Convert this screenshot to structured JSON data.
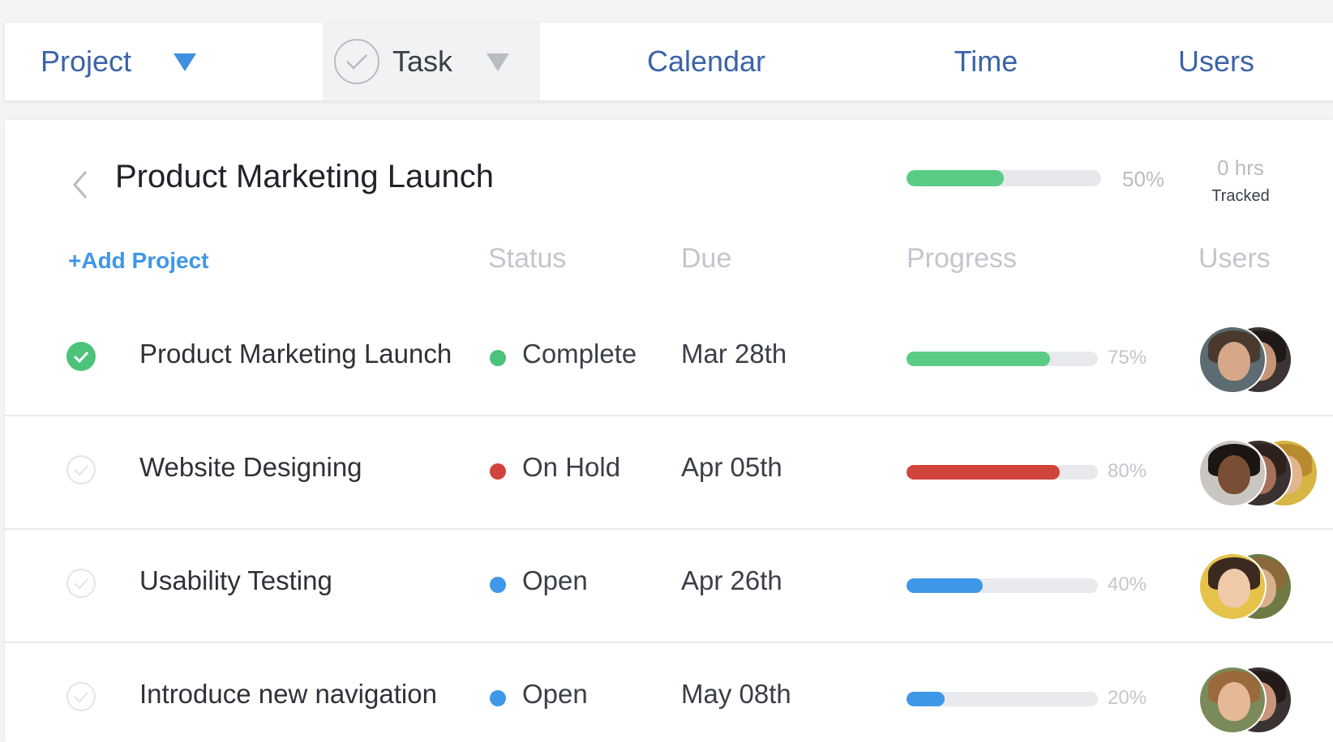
{
  "nav": {
    "project": "Project",
    "task": "Task",
    "calendar": "Calendar",
    "time": "Time",
    "users": "Users"
  },
  "header": {
    "title": "Product Marketing Launch",
    "progress": 50,
    "progress_label": "50%",
    "hours_value": "0 hrs",
    "hours_label": "Tracked"
  },
  "table": {
    "add_project": "+Add Project",
    "columns": {
      "status": "Status",
      "due": "Due",
      "progress": "Progress",
      "users": "Users"
    },
    "rows": [
      {
        "name": "Product Marketing Launch",
        "done": true,
        "status": "Complete",
        "status_color": "#4cc27a",
        "due": "Mar 28th",
        "progress": 75,
        "progress_label": "75%",
        "bar_color": "#5bcc85",
        "avatars": [
          {
            "skin": "#d6a889",
            "hair": "#4a3a2e",
            "bg": "#5d6b72"
          },
          {
            "skin": "#c59478",
            "hair": "#1f1a18",
            "bg": "#3c3533"
          }
        ]
      },
      {
        "name": "Website Designing",
        "done": false,
        "status": "On Hold",
        "status_color": "#d1443c",
        "due": "Apr 05th",
        "progress": 80,
        "progress_label": "80%",
        "bar_color": "#d1443c",
        "avatars": [
          {
            "skin": "#7a4e35",
            "hair": "#1b1513",
            "bg": "#c9c6c2"
          },
          {
            "skin": "#a4705a",
            "hair": "#2e211c",
            "bg": "#3a3230"
          },
          {
            "skin": "#e2b58f",
            "hair": "#b88a2e",
            "bg": "#d7b544"
          }
        ]
      },
      {
        "name": "Usability Testing",
        "done": false,
        "status": "Open",
        "status_color": "#3f97e8",
        "due": "Apr 26th",
        "progress": 40,
        "progress_label": "40%",
        "bar_color": "#3f97e8",
        "avatars": [
          {
            "skin": "#f0c9a8",
            "hair": "#3a2a20",
            "bg": "#e5c24a"
          },
          {
            "skin": "#d9b08c",
            "hair": "#8a6a3a",
            "bg": "#6d7a44"
          }
        ]
      },
      {
        "name": "Introduce new navigation",
        "done": false,
        "status": "Open",
        "status_color": "#3f97e8",
        "due": "May 08th",
        "progress": 20,
        "progress_label": "20%",
        "bar_color": "#3f97e8",
        "avatars": [
          {
            "skin": "#e5b896",
            "hair": "#9a6a3c",
            "bg": "#7b8a5a"
          },
          {
            "skin": "#c8957a",
            "hair": "#241b18",
            "bg": "#3a3331"
          }
        ]
      }
    ]
  }
}
